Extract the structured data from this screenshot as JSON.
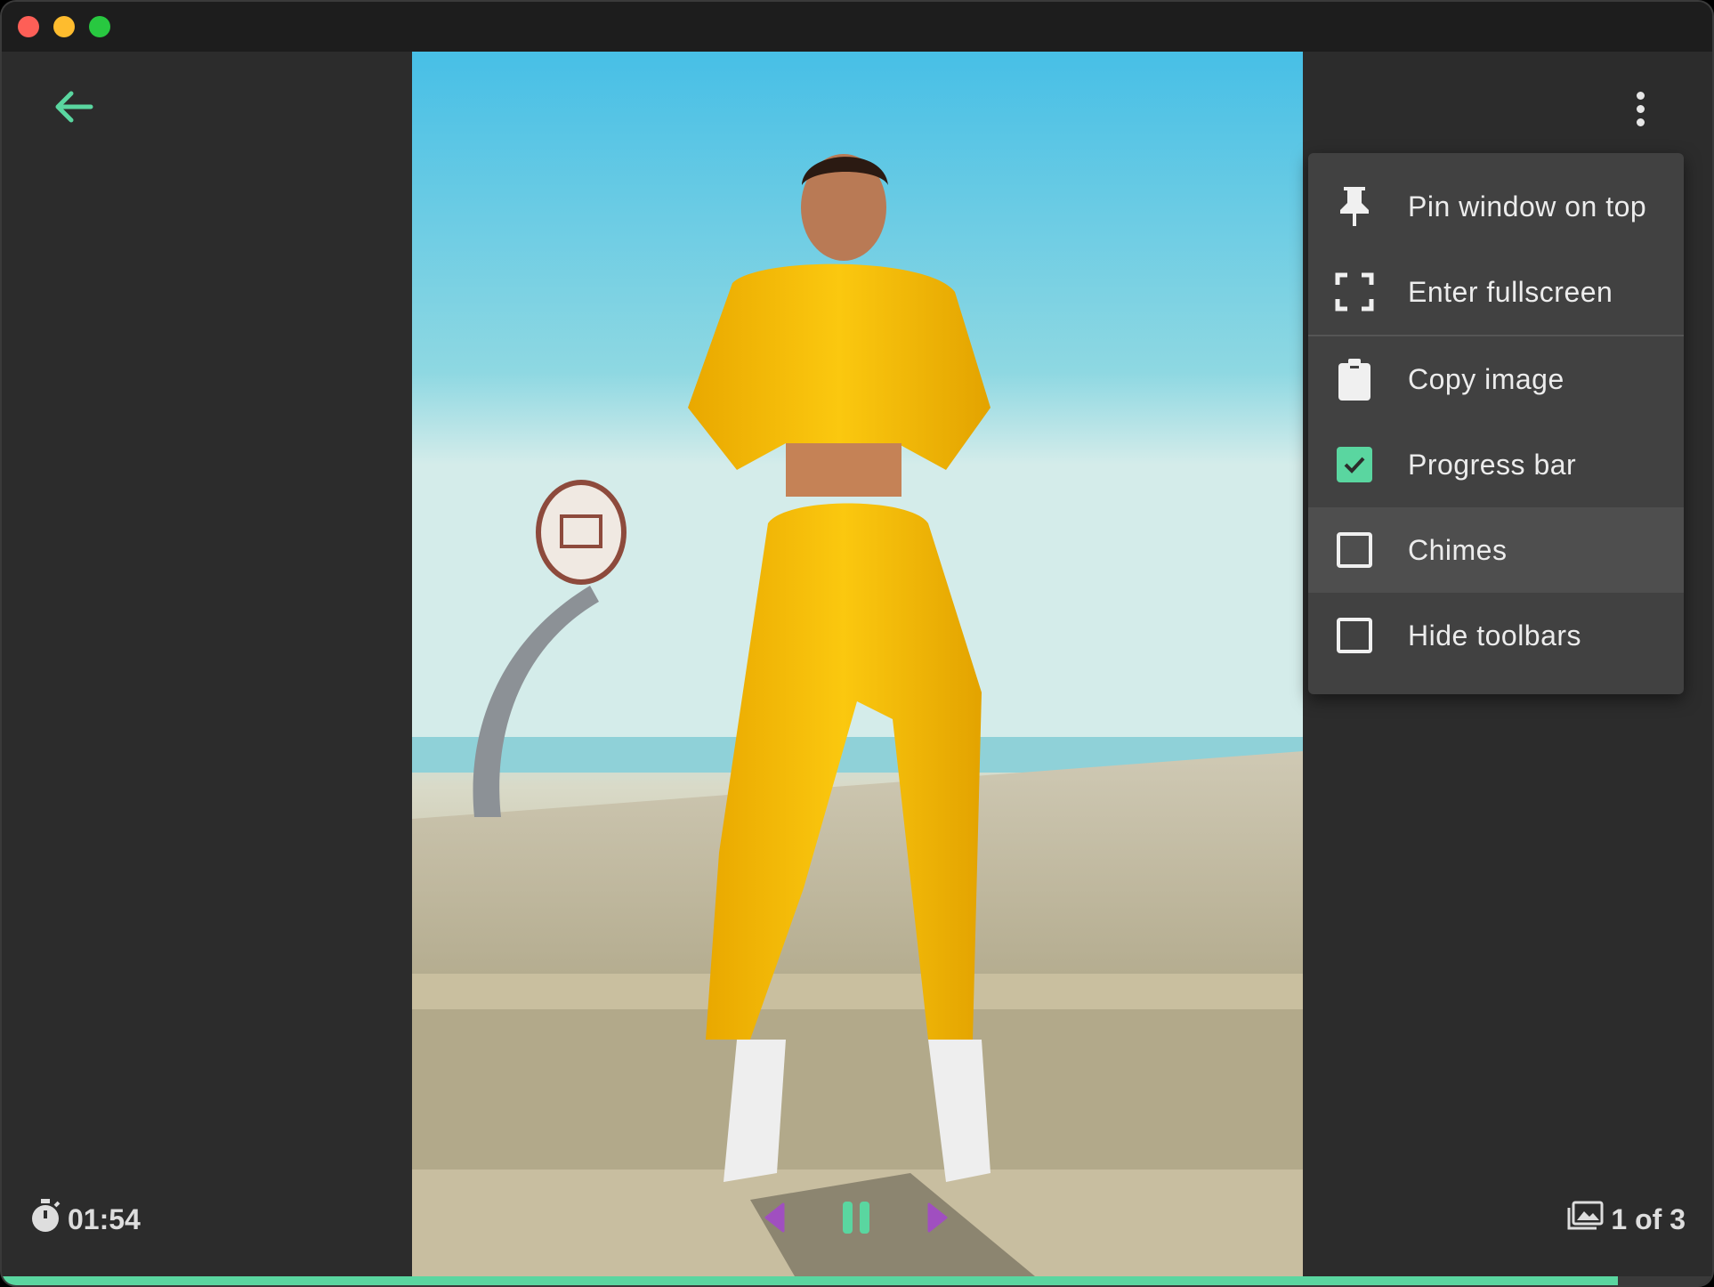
{
  "toolbar": {
    "back_icon": "arrow-left-icon",
    "more_icon": "more-vertical-icon"
  },
  "menu": {
    "items": [
      {
        "label": "Pin window on top",
        "icon": "pin-icon"
      },
      {
        "label": "Enter fullscreen",
        "icon": "fullscreen-icon"
      },
      {
        "label": "Copy image",
        "icon": "clipboard-icon"
      },
      {
        "label": "Progress bar",
        "icon": "checkbox-checked",
        "checked": true
      },
      {
        "label": "Chimes",
        "icon": "checkbox-unchecked",
        "checked": false,
        "hovered": true
      },
      {
        "label": "Hide toolbars",
        "icon": "checkbox-unchecked",
        "checked": false
      }
    ]
  },
  "status": {
    "timer": "01:54",
    "counter": "1 of 3"
  },
  "playback": {
    "prev_icon": "triangle-left-icon",
    "pause_icon": "pause-icon",
    "next_icon": "triangle-right-icon"
  },
  "progress": {
    "fraction": 0.945
  },
  "colors": {
    "accent": "#5ad6a0",
    "nav_arrows": "#a04fc0",
    "background": "#2c2c2c",
    "menu": "#414141"
  }
}
